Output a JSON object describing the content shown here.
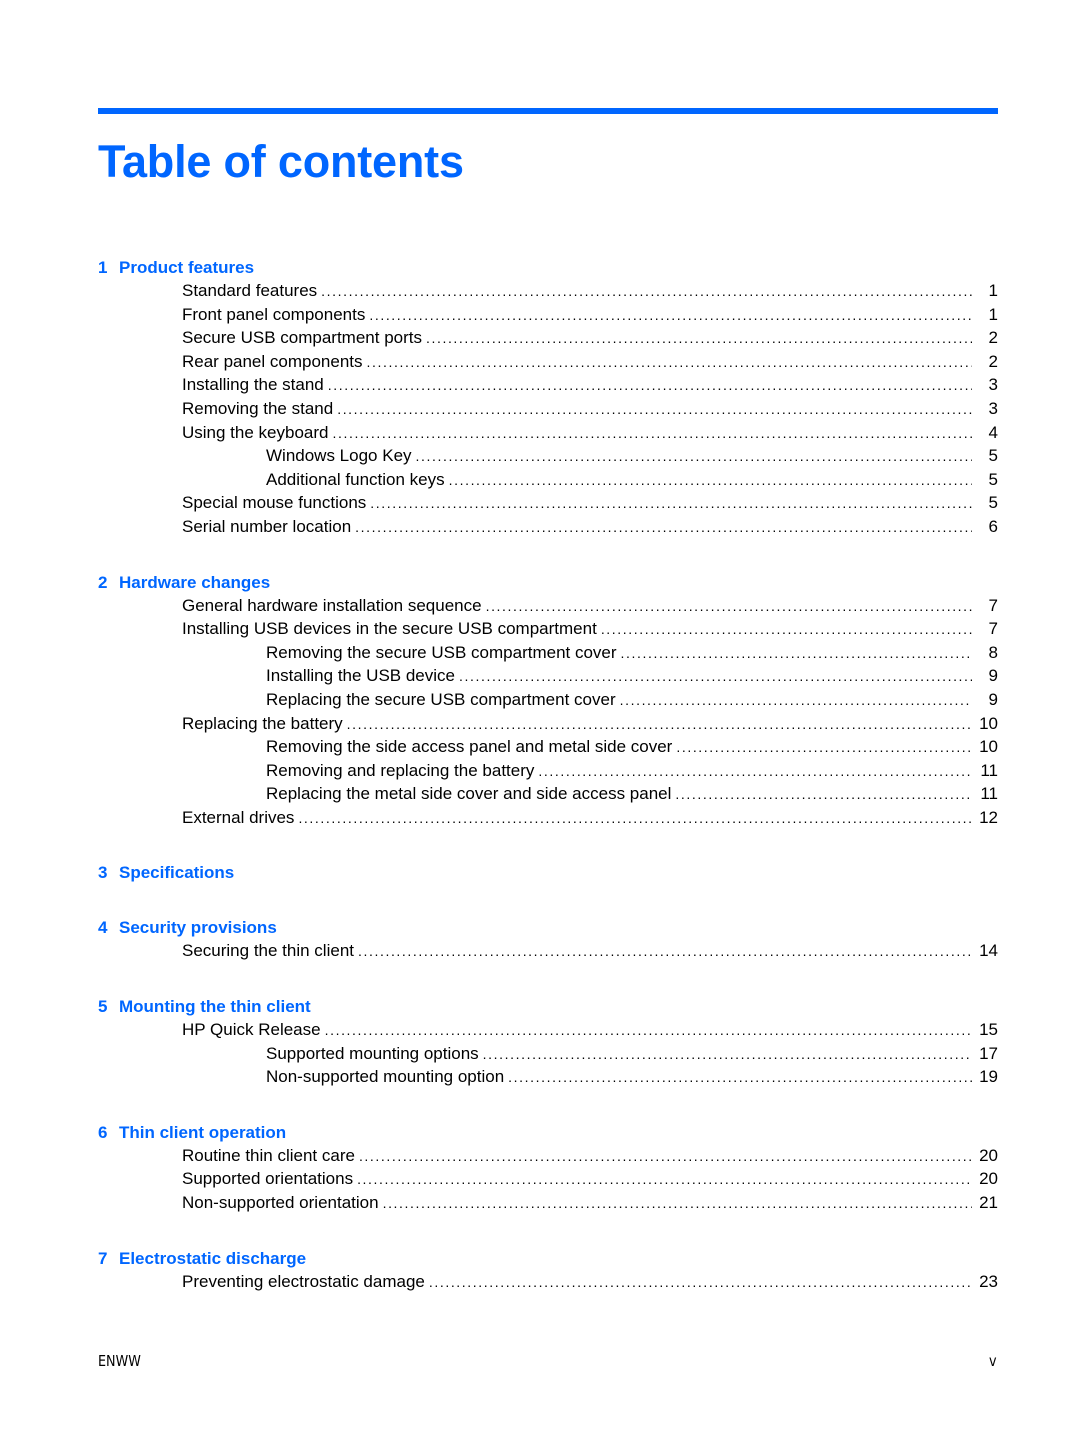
{
  "page": {
    "title": "Table of contents",
    "accent_color": "#0066ff",
    "footer_left": "ENWW",
    "footer_right": "v"
  },
  "chapters": [
    {
      "number": "1",
      "title": "Product features",
      "entries": [
        {
          "level": 1,
          "label": "Standard features",
          "page": "1"
        },
        {
          "level": 1,
          "label": "Front panel components",
          "page": "1"
        },
        {
          "level": 1,
          "label": "Secure USB compartment ports",
          "page": "2"
        },
        {
          "level": 1,
          "label": "Rear panel components",
          "page": "2"
        },
        {
          "level": 1,
          "label": "Installing the stand",
          "page": "3"
        },
        {
          "level": 1,
          "label": "Removing the stand",
          "page": "3"
        },
        {
          "level": 1,
          "label": "Using the keyboard",
          "page": "4"
        },
        {
          "level": 2,
          "label": "Windows Logo Key",
          "page": "5"
        },
        {
          "level": 2,
          "label": "Additional function keys",
          "page": "5"
        },
        {
          "level": 1,
          "label": "Special mouse functions",
          "page": "5"
        },
        {
          "level": 1,
          "label": "Serial number location",
          "page": "6"
        }
      ]
    },
    {
      "number": "2",
      "title": "Hardware changes",
      "entries": [
        {
          "level": 1,
          "label": "General hardware installation sequence",
          "page": "7"
        },
        {
          "level": 1,
          "label": "Installing USB devices in the secure USB compartment",
          "page": "7"
        },
        {
          "level": 2,
          "label": "Removing the secure USB compartment cover",
          "page": "8"
        },
        {
          "level": 2,
          "label": "Installing the USB device",
          "page": "9"
        },
        {
          "level": 2,
          "label": "Replacing the secure USB compartment cover",
          "page": "9"
        },
        {
          "level": 1,
          "label": "Replacing the battery",
          "page": "10"
        },
        {
          "level": 2,
          "label": "Removing the side access panel and metal side cover",
          "page": "10"
        },
        {
          "level": 2,
          "label": "Removing and replacing the battery",
          "page": "11"
        },
        {
          "level": 2,
          "label": "Replacing the metal side cover and side access panel",
          "page": "11"
        },
        {
          "level": 1,
          "label": "External drives",
          "page": "12"
        }
      ]
    },
    {
      "number": "3",
      "title": "Specifications",
      "entries": []
    },
    {
      "number": "4",
      "title": "Security provisions",
      "entries": [
        {
          "level": 1,
          "label": "Securing the thin client",
          "page": "14"
        }
      ]
    },
    {
      "number": "5",
      "title": "Mounting the thin client",
      "entries": [
        {
          "level": 1,
          "label": "HP Quick Release",
          "page": "15"
        },
        {
          "level": 2,
          "label": "Supported mounting options",
          "page": "17"
        },
        {
          "level": 2,
          "label": "Non-supported mounting option",
          "page": "19"
        }
      ]
    },
    {
      "number": "6",
      "title": "Thin client operation",
      "entries": [
        {
          "level": 1,
          "label": "Routine thin client care",
          "page": "20"
        },
        {
          "level": 1,
          "label": "Supported orientations",
          "page": "20"
        },
        {
          "level": 1,
          "label": "Non-supported orientation",
          "page": "21"
        }
      ]
    },
    {
      "number": "7",
      "title": "Electrostatic discharge",
      "entries": [
        {
          "level": 1,
          "label": "Preventing electrostatic damage",
          "page": "23"
        }
      ]
    }
  ]
}
